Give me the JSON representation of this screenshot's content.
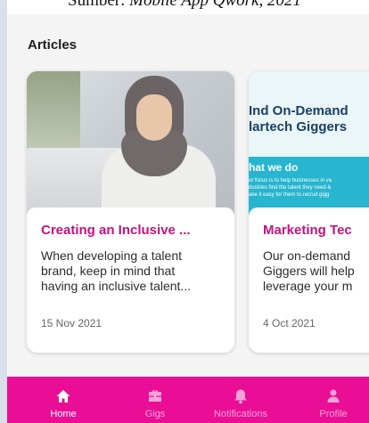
{
  "caption": {
    "prefix": "Sumber: ",
    "source": "Mobile App Qwork, 2021"
  },
  "section": {
    "title": "Articles"
  },
  "articles": [
    {
      "title": "Creating an Inclusive ...",
      "excerpt": "When developing a talent\nbrand, keep in mind that\nhaving an inclusive talent...",
      "date": "15 Nov 2021"
    },
    {
      "title": "Marketing Tec",
      "excerpt": "Our on-demand\nGiggers will help\nleverage your m",
      "date": "4 Oct 2021",
      "poster": {
        "title": "Ind On-Demand\nlartech Giggers",
        "heading": "hat we do",
        "text": "ur focus is to help businesses in va\ndustries find the talent they need &\nake it easy for them to recruit gigg"
      }
    }
  ],
  "nav": {
    "accent": "#ea0e96",
    "items": [
      {
        "label": "Home",
        "icon": "home-icon",
        "active": true
      },
      {
        "label": "Gigs",
        "icon": "briefcase-icon",
        "active": false
      },
      {
        "label": "Notifications",
        "icon": "bell-icon",
        "active": false
      },
      {
        "label": "Profile",
        "icon": "user-icon",
        "active": false
      }
    ]
  }
}
